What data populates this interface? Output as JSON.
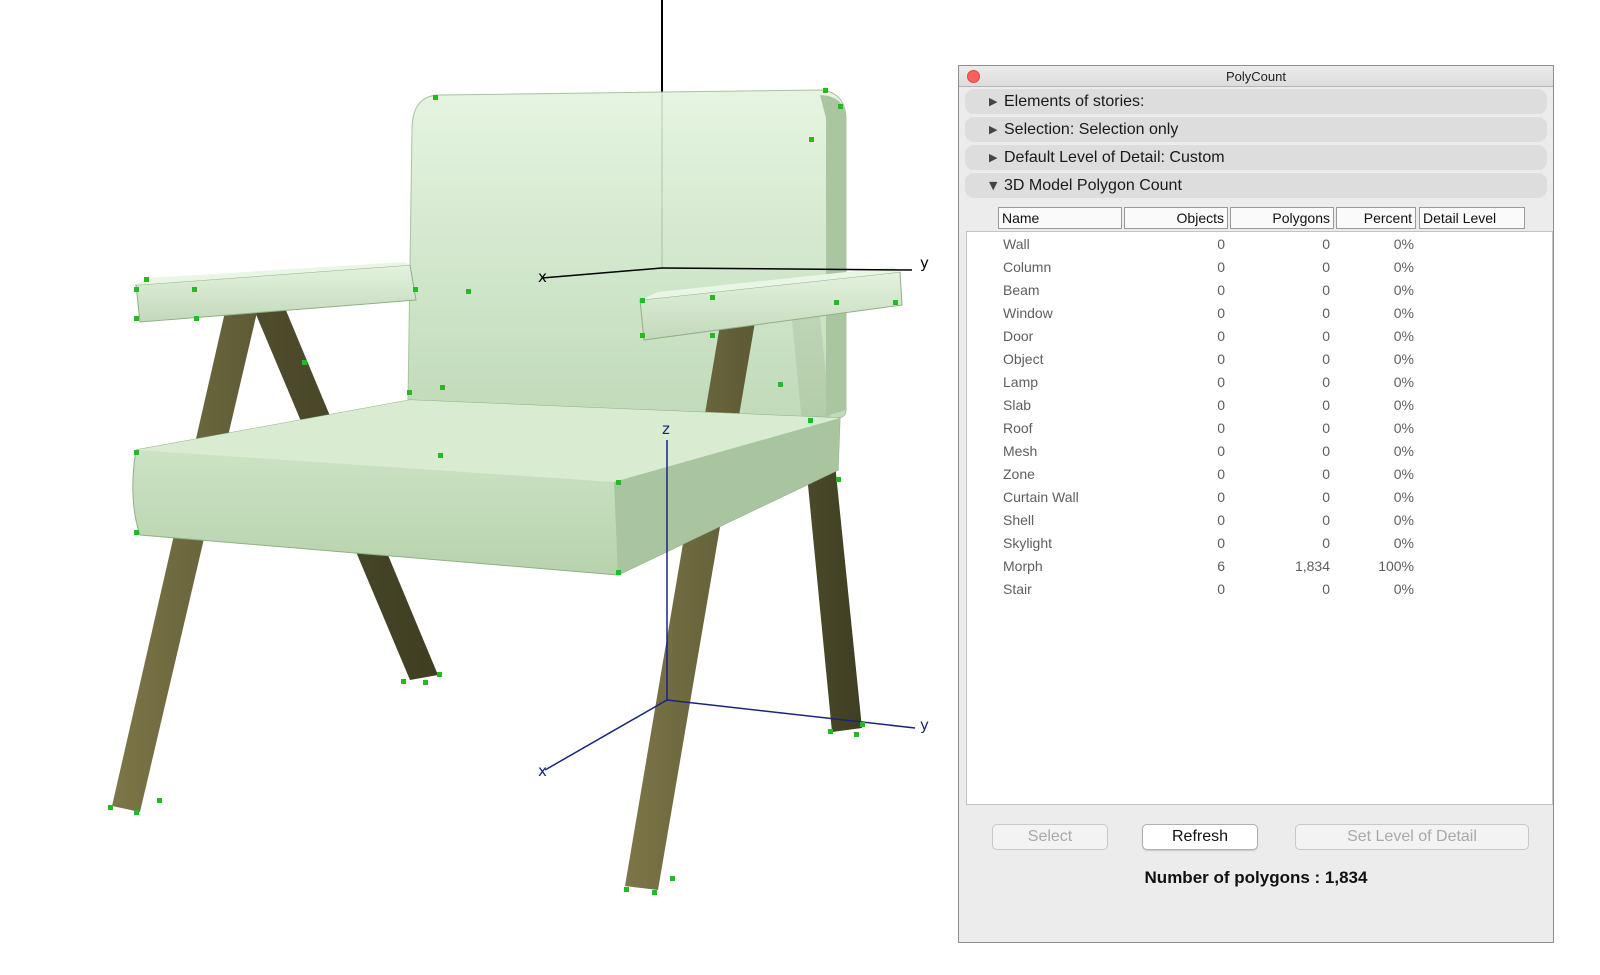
{
  "viewport": {
    "upper_axis_x_label": "x",
    "upper_axis_y_label": "y",
    "lower_axis_x_label": "x",
    "lower_axis_y_label": "y",
    "lower_axis_z_label": "z"
  },
  "window": {
    "title": "PolyCount",
    "sections": [
      {
        "label": "Elements of stories:",
        "expanded": false
      },
      {
        "label": "Selection: Selection only",
        "expanded": false
      },
      {
        "label": "Default Level of Detail: Custom",
        "expanded": false
      },
      {
        "label": "3D Model Polygon Count",
        "expanded": true
      }
    ],
    "table": {
      "headers": {
        "name": "Name",
        "objects": "Objects",
        "polygons": "Polygons",
        "percent": "Percent",
        "detail": "Detail Level"
      },
      "rows": [
        {
          "name": "Wall",
          "objects": "0",
          "polygons": "0",
          "percent": "0%"
        },
        {
          "name": "Column",
          "objects": "0",
          "polygons": "0",
          "percent": "0%"
        },
        {
          "name": "Beam",
          "objects": "0",
          "polygons": "0",
          "percent": "0%"
        },
        {
          "name": "Window",
          "objects": "0",
          "polygons": "0",
          "percent": "0%"
        },
        {
          "name": "Door",
          "objects": "0",
          "polygons": "0",
          "percent": "0%"
        },
        {
          "name": "Object",
          "objects": "0",
          "polygons": "0",
          "percent": "0%"
        },
        {
          "name": "Lamp",
          "objects": "0",
          "polygons": "0",
          "percent": "0%"
        },
        {
          "name": "Slab",
          "objects": "0",
          "polygons": "0",
          "percent": "0%"
        },
        {
          "name": "Roof",
          "objects": "0",
          "polygons": "0",
          "percent": "0%"
        },
        {
          "name": "Mesh",
          "objects": "0",
          "polygons": "0",
          "percent": "0%"
        },
        {
          "name": "Zone",
          "objects": "0",
          "polygons": "0",
          "percent": "0%"
        },
        {
          "name": "Curtain Wall",
          "objects": "0",
          "polygons": "0",
          "percent": "0%"
        },
        {
          "name": "Shell",
          "objects": "0",
          "polygons": "0",
          "percent": "0%"
        },
        {
          "name": "Skylight",
          "objects": "0",
          "polygons": "0",
          "percent": "0%"
        },
        {
          "name": "Morph",
          "objects": "6",
          "polygons": "1,834",
          "percent": "100%"
        },
        {
          "name": "Stair",
          "objects": "0",
          "polygons": "0",
          "percent": "0%"
        }
      ]
    },
    "buttons": {
      "select": "Select",
      "refresh": "Refresh",
      "set_lod": "Set Level of Detail"
    },
    "total_label": "Number of polygons : 1,834"
  },
  "colors": {
    "cushion": "#cfe6c8",
    "wood": "#6f6a3f",
    "vertex_marker": "#22bb22",
    "lower_axis": "#1a237e"
  }
}
